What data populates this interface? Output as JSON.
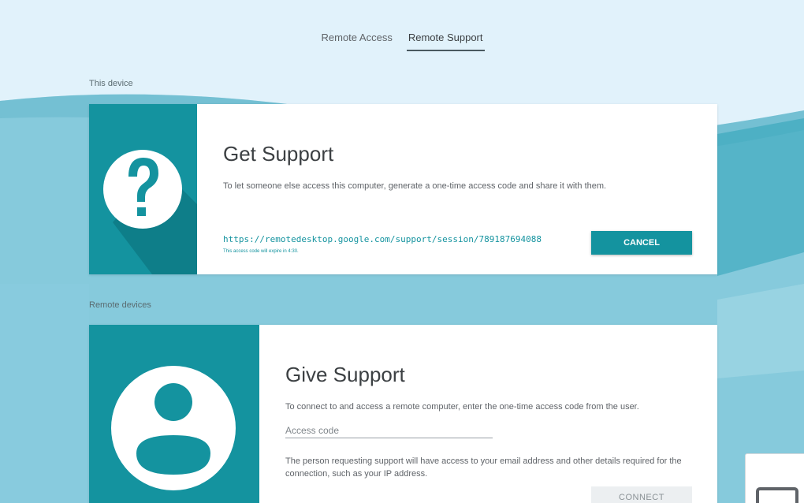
{
  "tabs": [
    {
      "label": "Remote Access",
      "active": false
    },
    {
      "label": "Remote Support",
      "active": true
    }
  ],
  "sections": {
    "this_device": "This device",
    "remote_devices": "Remote devices"
  },
  "get_support": {
    "title": "Get Support",
    "description": "To let someone else access this computer, generate a one-time access code and share it with them.",
    "session_url": "https://remotedesktop.google.com/support/session/789187694088",
    "expire_note": "This access code will expire in 4:30.",
    "cancel_label": "CANCEL",
    "icon": "question-mark-icon"
  },
  "give_support": {
    "title": "Give Support",
    "description": "To connect to and access a remote computer, enter the one-time access code from the user.",
    "access_code_placeholder": "Access code",
    "access_code_value": "",
    "note": "The person requesting support will have access to your email address and other details required for the connection, such as your IP address.",
    "connect_label": "CONNECT",
    "icon": "person-icon"
  },
  "colors": {
    "accent": "#14939f",
    "accent_dark": "#0e7e89",
    "sky": "#e0f1fa",
    "background": "#7fc7da"
  }
}
